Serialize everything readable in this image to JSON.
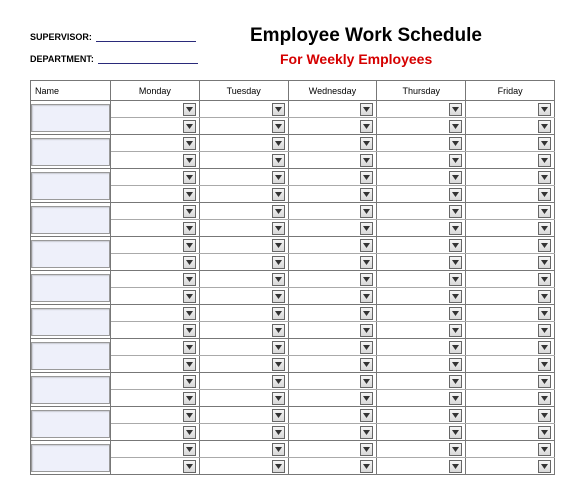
{
  "header": {
    "supervisor_label": "SUPERVISOR:",
    "supervisor_value": "",
    "department_label": "DEPARTMENT:",
    "department_value": "",
    "title": "Employee Work Schedule",
    "subtitle": "For Weekly Employees"
  },
  "columns": {
    "name": "Name",
    "days": [
      "Monday",
      "Tuesday",
      "Wednesday",
      "Thursday",
      "Friday"
    ]
  },
  "rows": [
    {
      "name": "",
      "cells": [
        "",
        "",
        "",
        "",
        "",
        "",
        "",
        "",
        "",
        ""
      ]
    },
    {
      "name": "",
      "cells": [
        "",
        "",
        "",
        "",
        "",
        "",
        "",
        "",
        "",
        ""
      ]
    },
    {
      "name": "",
      "cells": [
        "",
        "",
        "",
        "",
        "",
        "",
        "",
        "",
        "",
        ""
      ]
    },
    {
      "name": "",
      "cells": [
        "",
        "",
        "",
        "",
        "",
        "",
        "",
        "",
        "",
        ""
      ]
    },
    {
      "name": "",
      "cells": [
        "",
        "",
        "",
        "",
        "",
        "",
        "",
        "",
        "",
        ""
      ]
    },
    {
      "name": "",
      "cells": [
        "",
        "",
        "",
        "",
        "",
        "",
        "",
        "",
        "",
        ""
      ]
    },
    {
      "name": "",
      "cells": [
        "",
        "",
        "",
        "",
        "",
        "",
        "",
        "",
        "",
        ""
      ]
    },
    {
      "name": "",
      "cells": [
        "",
        "",
        "",
        "",
        "",
        "",
        "",
        "",
        "",
        ""
      ]
    },
    {
      "name": "",
      "cells": [
        "",
        "",
        "",
        "",
        "",
        "",
        "",
        "",
        "",
        ""
      ]
    },
    {
      "name": "",
      "cells": [
        "",
        "",
        "",
        "",
        "",
        "",
        "",
        "",
        "",
        ""
      ]
    },
    {
      "name": "",
      "cells": [
        "",
        "",
        "",
        "",
        "",
        "",
        "",
        "",
        "",
        ""
      ]
    }
  ]
}
